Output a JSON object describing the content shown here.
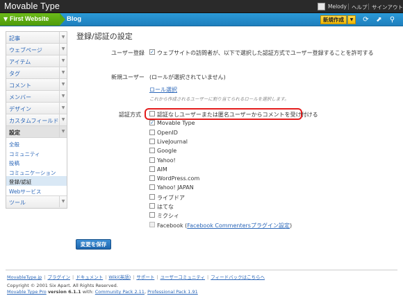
{
  "header": {
    "app_title": "Movable Type",
    "user": "Melody",
    "help": "ヘルプ",
    "signout": "サインアウト"
  },
  "sitebar": {
    "website": "First Website",
    "blog": "Blog",
    "new_label": "新規作成"
  },
  "sidebar": {
    "items": [
      {
        "label": "記事"
      },
      {
        "label": "ウェブページ"
      },
      {
        "label": "アイテム"
      },
      {
        "label": "タグ"
      },
      {
        "label": "コメント"
      },
      {
        "label": "メンバー"
      },
      {
        "label": "デザイン"
      },
      {
        "label": "カスタムフィールド"
      }
    ],
    "settings": {
      "label": "設定",
      "subitems": [
        "全般",
        "コミュニティ",
        "投稿",
        "コミュニケーション",
        "登録/認証",
        "Webサービス"
      ]
    },
    "tools": {
      "label": "ツール"
    }
  },
  "main": {
    "title": "登録/認証の設定",
    "user_registration": {
      "label": "ユーザー登録",
      "checkbox_text": "ウェブサイトの訪問者が、以下で選択した認証方式でユーザー登録することを許可する"
    },
    "new_user": {
      "label": "新規ユーザー",
      "value": "(ロールが選択されていません)",
      "role_link": "ロール選択",
      "hint": "これから作成されるユーザーに割り当てられるロールを選択します。"
    },
    "auth_methods": {
      "label": "認証方式",
      "options": [
        {
          "text": "認証なしユーザーまたは匿名ユーザーからコメントを受け付ける",
          "checked": false
        },
        {
          "text": "Movable Type",
          "checked": true
        },
        {
          "text": "OpenID",
          "checked": false
        },
        {
          "text": "LiveJournal",
          "checked": false
        },
        {
          "text": "Google",
          "checked": false
        },
        {
          "text": "Yahoo!",
          "checked": false
        },
        {
          "text": "AIM",
          "checked": false
        },
        {
          "text": "WordPress.com",
          "checked": false
        },
        {
          "text": "Yahoo! JAPAN",
          "checked": false
        },
        {
          "text": "ライブドア",
          "checked": false
        },
        {
          "text": "はてな",
          "checked": false
        },
        {
          "text": "ミクシィ",
          "checked": false
        }
      ],
      "facebook": {
        "text": "Facebook (",
        "link": "Facebook Commentersプラグイン設定",
        "close": ")"
      }
    },
    "save_label": "変更を保存"
  },
  "footer": {
    "links": [
      "MovableType.jp",
      "プラグイン",
      "ドキュメント",
      "Wiki(英語)",
      "サポート",
      "ユーザーコミュニティ",
      "フィードバックはこちらへ"
    ],
    "copyright": "Copyright © 2001 Six Apart. All Rights Reserved.",
    "product": "Movable Type Pro",
    "version": "version 6.1.1",
    "with": "with:",
    "community_pack": "Community Pack 2.11",
    "professional_pack": "Professional Pack 1.91"
  },
  "colors": {
    "accent": "#2a66b8",
    "site_green": "#5aa912",
    "sitebar_blue": "#1e7fbd",
    "highlight_red": "#e31b1b"
  }
}
